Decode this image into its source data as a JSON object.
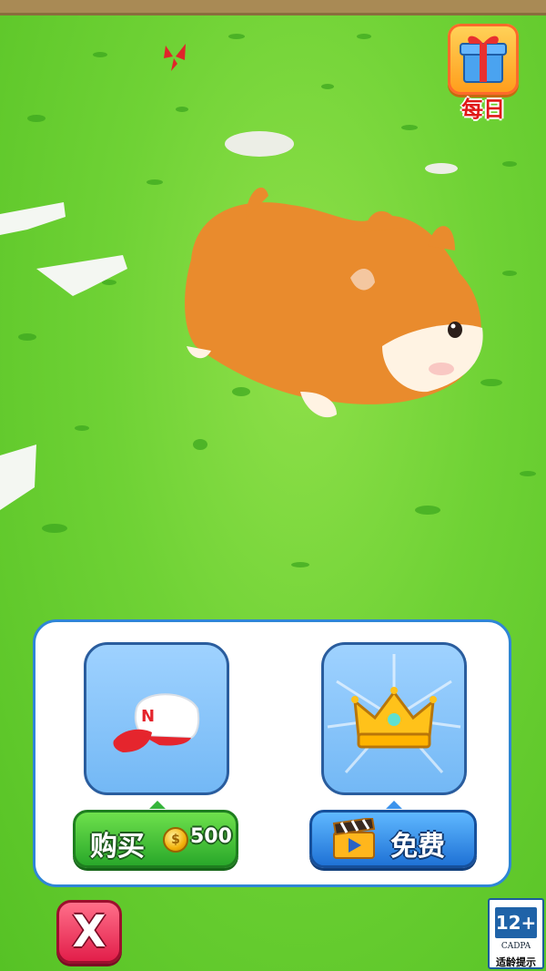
{
  "daily": {
    "label": "每日",
    "icon": "gift-box-icon"
  },
  "shop": {
    "items": [
      {
        "icon": "baseball-cap-icon",
        "cap_letter": "N",
        "button_label": "购买",
        "currency_icon": "coin-icon",
        "price": "500",
        "button_color": "#29a82a"
      },
      {
        "icon": "crown-icon",
        "button_icon": "clapperboard-icon",
        "button_label": "免费",
        "button_color": "#1f72d6"
      }
    ]
  },
  "close": {
    "label": "X",
    "icon": "close-icon",
    "color": "#e21e4a"
  },
  "age_rating": {
    "rating": "12+",
    "org": "CADPA",
    "tip": "适龄提示"
  },
  "character": {
    "icon": "hamster-icon"
  }
}
